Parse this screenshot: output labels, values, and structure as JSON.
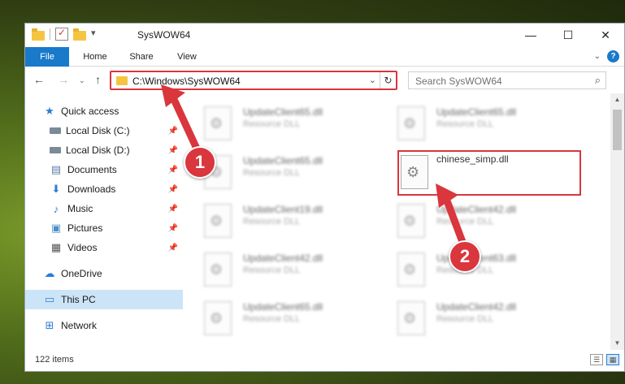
{
  "window": {
    "title": "SysWOW64",
    "controls": {
      "minimize": "—",
      "maximize": "☐",
      "close": "✕"
    }
  },
  "ribbon": {
    "tabs": [
      "File",
      "Home",
      "Share",
      "View"
    ],
    "help_label": "?"
  },
  "navigation": {
    "back": "←",
    "forward": "→",
    "recent": "⌄",
    "up": "↑",
    "address": "C:\\Windows\\SysWOW64",
    "address_dropdown": "⌄",
    "refresh": "↻",
    "search_placeholder": "Search SysWOW64",
    "search_icon": "⌕"
  },
  "sidebar": {
    "items": [
      {
        "label": "Quick access",
        "icon": "star-icon",
        "glyph": "★",
        "pinned": false
      },
      {
        "label": "Local Disk (C:)",
        "icon": "disk-icon",
        "glyph": "",
        "pinned": true
      },
      {
        "label": "Local Disk (D:)",
        "icon": "disk-icon",
        "glyph": "",
        "pinned": true
      },
      {
        "label": "Documents",
        "icon": "documents-icon",
        "glyph": "▤",
        "pinned": true
      },
      {
        "label": "Downloads",
        "icon": "download-icon",
        "glyph": "⬇",
        "pinned": true
      },
      {
        "label": "Music",
        "icon": "music-icon",
        "glyph": "♪",
        "pinned": true
      },
      {
        "label": "Pictures",
        "icon": "pictures-icon",
        "glyph": "▣",
        "pinned": true
      },
      {
        "label": "Videos",
        "icon": "videos-icon",
        "glyph": "▦",
        "pinned": true
      },
      {
        "label": "OneDrive",
        "icon": "cloud-icon",
        "glyph": "☁",
        "pinned": false
      },
      {
        "label": "This PC",
        "icon": "pc-icon",
        "glyph": "▭",
        "pinned": false,
        "selected": true
      },
      {
        "label": "Network",
        "icon": "network-icon",
        "glyph": "⊞",
        "pinned": false
      }
    ],
    "pin_glyph": "📌"
  },
  "files": [
    {
      "name": "UpdateClient65.dll",
      "type": "Resource DLL"
    },
    {
      "name": "UpdateClient65.dll",
      "type": "Resource DLL"
    },
    {
      "name": "UpdateClient65.dll",
      "type": "Resource DLL"
    },
    {
      "name": "chinese_simp.dll",
      "type": ""
    },
    {
      "name": "UpdateClient19.dll",
      "type": "Resource DLL"
    },
    {
      "name": "UpdateClient42.dll",
      "type": "Resource DLL"
    },
    {
      "name": "UpdateClient42.dll",
      "type": "Resource DLL"
    },
    {
      "name": "UpdateClient63.dll",
      "type": "Resource DLL"
    },
    {
      "name": "UpdateClient65.dll",
      "type": "Resource DLL"
    },
    {
      "name": "UpdateClient42.dll",
      "type": "Resource DLL"
    }
  ],
  "status": {
    "item_count": "122 items"
  },
  "callouts": {
    "step1": "1",
    "step2": "2"
  },
  "colors": {
    "accent": "#1979ca",
    "highlight": "#d9363e",
    "selection": "#cce4f7"
  }
}
